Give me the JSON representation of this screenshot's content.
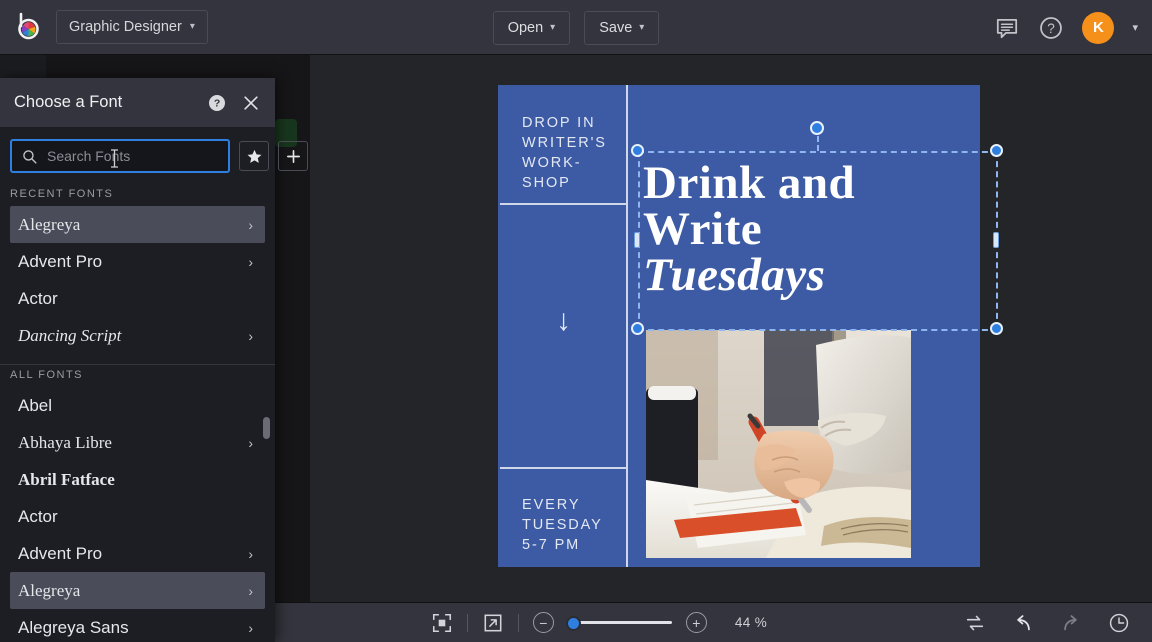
{
  "app": {
    "logo_icon": "color-wheel-logo",
    "doc_type": "Graphic Designer",
    "doc_type_chevron": "▾"
  },
  "topbar": {
    "open_label": "Open",
    "open_chevron": "▾",
    "save_label": "Save",
    "save_chevron": "▾",
    "feedback_icon": "speech-bubble-icon",
    "help_icon": "question-circle-icon",
    "avatar_initial": "K",
    "avatar_chevron": "▾",
    "avatar_color": "#f5901a"
  },
  "font_panel": {
    "title": "Choose a Font",
    "help_icon": "help-circle-icon",
    "close_icon": "close-x-icon",
    "search": {
      "placeholder": "Search Fonts",
      "value": "",
      "icon": "search-icon"
    },
    "favorites_icon": "star-icon",
    "add_icon": "plus-icon",
    "recent_label": "RECENT FONTS",
    "all_label": "ALL FONTS",
    "recent_fonts": [
      {
        "name": "Alegreya",
        "style": "serif",
        "chevron": "›",
        "selected": true
      },
      {
        "name": "Advent Pro",
        "style": "sans",
        "chevron": "›",
        "selected": false
      },
      {
        "name": "Actor",
        "style": "sans",
        "chevron": "",
        "selected": false
      },
      {
        "name": "Dancing Script",
        "style": "script",
        "chevron": "›",
        "selected": false
      }
    ],
    "all_fonts": [
      {
        "name": "Abel",
        "style": "sans",
        "chevron": "",
        "selected": false
      },
      {
        "name": "Abhaya Libre",
        "style": "serif",
        "chevron": "›",
        "selected": false
      },
      {
        "name": "Abril Fatface",
        "style": "bold",
        "chevron": "",
        "selected": false
      },
      {
        "name": "Actor",
        "style": "sans",
        "chevron": "",
        "selected": false
      },
      {
        "name": "Advent Pro",
        "style": "sans",
        "chevron": "›",
        "selected": false
      },
      {
        "name": "Alegreya",
        "style": "serif",
        "chevron": "›",
        "selected": true
      },
      {
        "name": "Alegreya Sans",
        "style": "sans",
        "chevron": "›",
        "selected": false
      }
    ]
  },
  "canvas": {
    "poster": {
      "background_color": "#3c5ba4",
      "top_left_text": "DROP IN\nWRITER'S\nWORK-\nSHOP",
      "arrow_glyph": "↓",
      "bottom_left_text": "EVERY\nTUESDAY\n5-7 PM",
      "headline_line1": "Drink and",
      "headline_line2": "Write",
      "headline_line3_italic": "Tuesdays",
      "photo_alt": "hand-writing-in-notebook-photo"
    },
    "selection": {
      "handle_color": "#2f7fe0",
      "outline_color": "#8fb6f0"
    }
  },
  "bottombar": {
    "layers_icon": "layers-icon",
    "panel_icon": "panel-layout-icon",
    "fit_icon": "fit-to-screen-icon",
    "expand_icon": "expand-arrow-icon",
    "zoom_out_icon": "minus-icon",
    "zoom_in_icon": "plus-icon",
    "zoom_level": "44 %",
    "swap_icon": "swap-arrows-icon",
    "undo_icon": "undo-arrow-icon",
    "redo_icon": "redo-arrow-icon",
    "history_icon": "history-clock-icon"
  }
}
